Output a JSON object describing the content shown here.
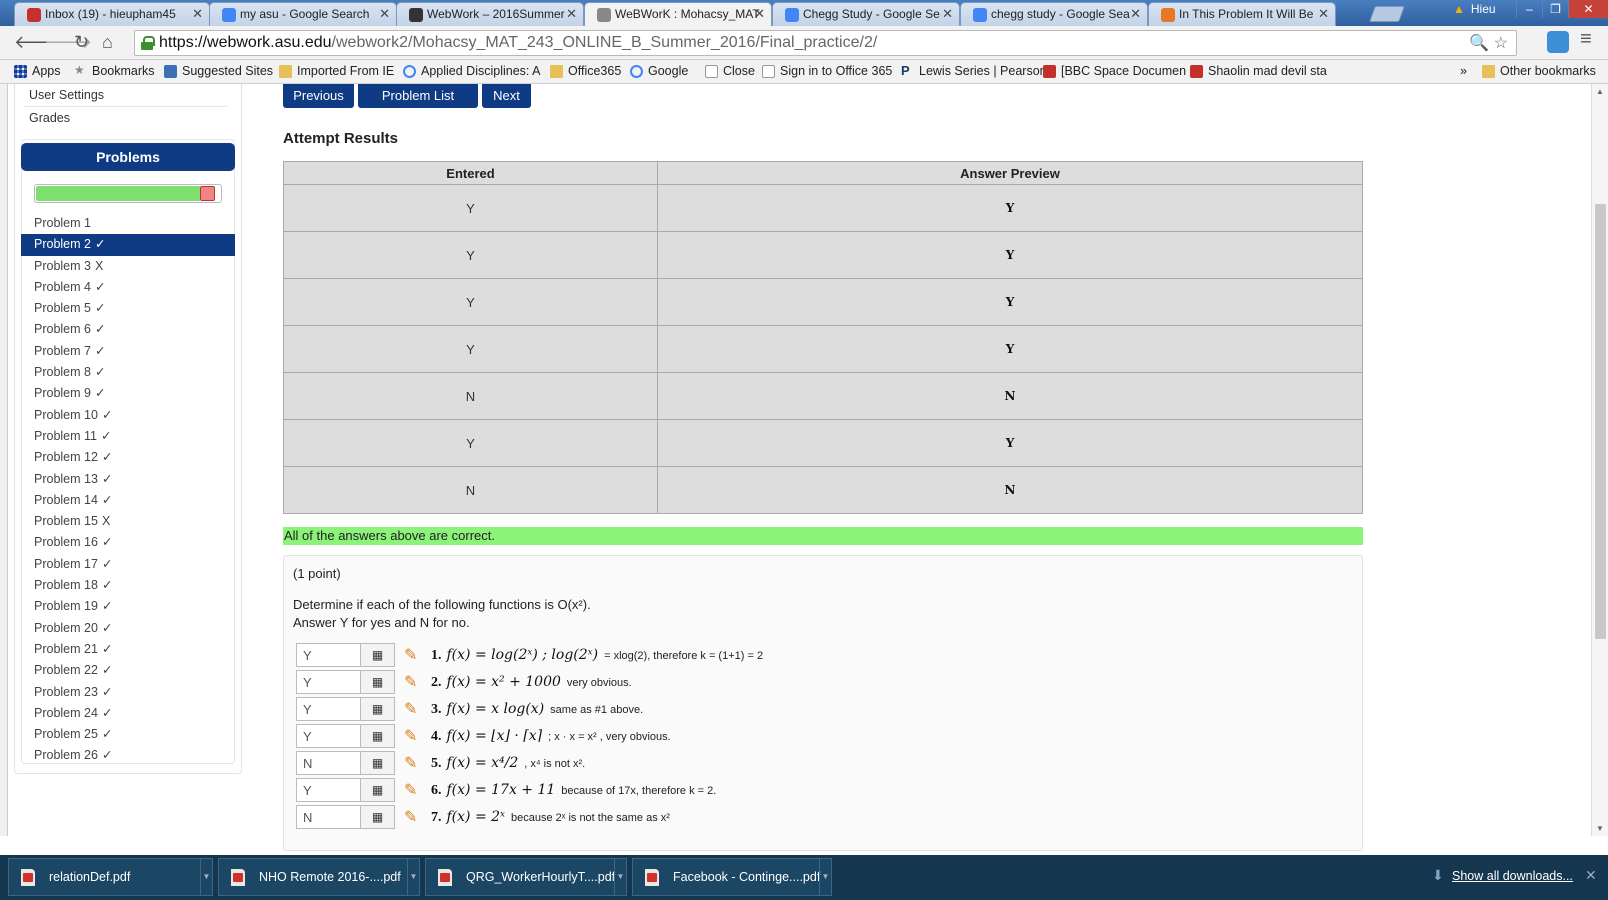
{
  "browser": {
    "tabs": [
      {
        "title": "Inbox (19) - hieupham45",
        "favicon": "gmail-icon",
        "color": "#c4302b",
        "active": false
      },
      {
        "title": "my asu - Google Search",
        "favicon": "google-icon",
        "color": "#4285f4",
        "active": false
      },
      {
        "title": "WebWork – 2016Summer",
        "favicon": "blackboard-icon",
        "color": "#333333",
        "active": false
      },
      {
        "title": "WeBWorK : Mohacsy_MAT",
        "favicon": "page-icon",
        "color": "#888888",
        "active": true
      },
      {
        "title": "Chegg Study - Google Se",
        "favicon": "google-icon",
        "color": "#4285f4",
        "active": false
      },
      {
        "title": "chegg study - Google Sea",
        "favicon": "google-icon",
        "color": "#4285f4",
        "active": false
      },
      {
        "title": "In This Problem It Will Be",
        "favicon": "chegg-icon",
        "color": "#e87722",
        "active": false
      }
    ],
    "user": "Hieu",
    "url_host": "https://webwork.asu.edu",
    "url_path": "/webwork2/Mohacsy_MAT_243_ONLINE_B_Summer_2016/Final_practice/2/",
    "bookmarks": [
      {
        "label": "Apps",
        "icon": "apps-grid"
      },
      {
        "label": "Bookmarks",
        "icon": "star"
      },
      {
        "label": "Suggested Sites",
        "icon": "bing"
      },
      {
        "label": "Imported From IE",
        "icon": "folder"
      },
      {
        "label": "Applied Disciplines: A",
        "icon": "asu"
      },
      {
        "label": "Office365",
        "icon": "folder"
      },
      {
        "label": "Google",
        "icon": "google"
      },
      {
        "label": "Close",
        "icon": "page"
      },
      {
        "label": "Sign in to Office 365",
        "icon": "office"
      },
      {
        "label": "Lewis Series | Pearson",
        "icon": "pearson"
      },
      {
        "label": "[BBC Space Documen",
        "icon": "youtube"
      },
      {
        "label": "Shaolin mad devil sta",
        "icon": "youtube"
      }
    ],
    "more_bookmarks": "»",
    "other_bookmarks": "Other bookmarks"
  },
  "sidebar": {
    "links": [
      "User Settings",
      "Grades"
    ],
    "problems_title": "Problems",
    "progress": {
      "correct_fraction": 0.88,
      "wrong_fraction": 0.08
    },
    "problems": [
      {
        "label": "Problem 1",
        "status": ""
      },
      {
        "label": "Problem 2",
        "status": "✓",
        "active": true
      },
      {
        "label": "Problem 3",
        "status": "X"
      },
      {
        "label": "Problem 4",
        "status": "✓"
      },
      {
        "label": "Problem 5",
        "status": "✓"
      },
      {
        "label": "Problem 6",
        "status": "✓"
      },
      {
        "label": "Problem 7",
        "status": "✓"
      },
      {
        "label": "Problem 8",
        "status": "✓"
      },
      {
        "label": "Problem 9",
        "status": "✓"
      },
      {
        "label": "Problem 10",
        "status": "✓"
      },
      {
        "label": "Problem 11",
        "status": "✓"
      },
      {
        "label": "Problem 12",
        "status": "✓"
      },
      {
        "label": "Problem 13",
        "status": "✓"
      },
      {
        "label": "Problem 14",
        "status": "✓"
      },
      {
        "label": "Problem 15",
        "status": "X"
      },
      {
        "label": "Problem 16",
        "status": "✓"
      },
      {
        "label": "Problem 17",
        "status": "✓"
      },
      {
        "label": "Problem 18",
        "status": "✓"
      },
      {
        "label": "Problem 19",
        "status": "✓"
      },
      {
        "label": "Problem 20",
        "status": "✓"
      },
      {
        "label": "Problem 21",
        "status": "✓"
      },
      {
        "label": "Problem 22",
        "status": "✓"
      },
      {
        "label": "Problem 23",
        "status": "✓"
      },
      {
        "label": "Problem 24",
        "status": "✓"
      },
      {
        "label": "Problem 25",
        "status": "✓"
      },
      {
        "label": "Problem 26",
        "status": "✓"
      }
    ]
  },
  "main": {
    "nav_buttons": {
      "previous": "Previous",
      "problem_list": "Problem List",
      "next": "Next"
    },
    "attempt_title": "Attempt Results",
    "results_headers": {
      "entered": "Entered",
      "preview": "Answer Preview"
    },
    "results": [
      {
        "entered": "Y",
        "preview": "Y"
      },
      {
        "entered": "Y",
        "preview": "Y"
      },
      {
        "entered": "Y",
        "preview": "Y"
      },
      {
        "entered": "Y",
        "preview": "Y"
      },
      {
        "entered": "N",
        "preview": "N"
      },
      {
        "entered": "Y",
        "preview": "Y"
      },
      {
        "entered": "N",
        "preview": "N"
      }
    ],
    "correct_message": "All of the answers above are correct.",
    "points": "(1 point)",
    "question_line1": "Determine if each of the following functions is O(x²).",
    "question_line2": "Answer Y for yes and N for no.",
    "answers": [
      {
        "value": "Y",
        "num": "1.",
        "expr": "f(x) = log(2ˣ) ;   log(2ˣ)",
        "note": "= xlog(2), therefore k = (1+1) = 2"
      },
      {
        "value": "Y",
        "num": "2.",
        "expr": "f(x) = x² + 1000",
        "note": "very obvious."
      },
      {
        "value": "Y",
        "num": "3.",
        "expr": "f(x) = x log(x)",
        "note": "same as #1 above."
      },
      {
        "value": "Y",
        "num": "4.",
        "expr": "f(x) = ⌊x⌋ · ⌈x⌉",
        "note": "; x · x = x² , very obvious."
      },
      {
        "value": "N",
        "num": "5.",
        "expr": "f(x) = x⁴/2",
        "note": ", x⁴ is not x²."
      },
      {
        "value": "Y",
        "num": "6.",
        "expr": "f(x) = 17x + 11",
        "note": "because of 17x, therefore k = 2."
      },
      {
        "value": "N",
        "num": "7.",
        "expr": "f(x) = 2ˣ",
        "note": "because 2ˣ is not the same as x²"
      }
    ]
  },
  "downloads": {
    "files": [
      "relationDef.pdf",
      "NHO Remote 2016-....pdf",
      "QRG_WorkerHourlyT....pdf",
      "Facebook - Continge....pdf"
    ],
    "show_all": "Show all downloads..."
  }
}
